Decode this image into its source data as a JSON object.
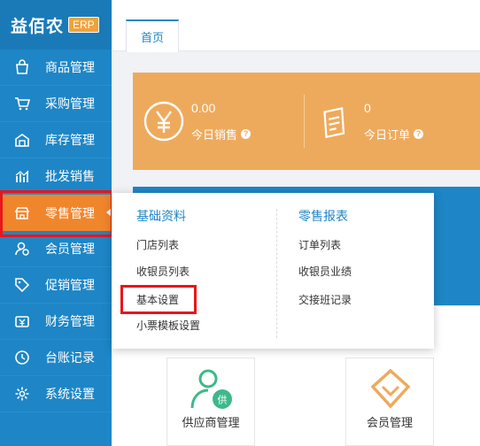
{
  "app": {
    "name": "益佰农",
    "badge": "ERP"
  },
  "sidebar": {
    "items": [
      {
        "label": "商品管理",
        "icon": "bag-icon"
      },
      {
        "label": "采购管理",
        "icon": "cart-icon"
      },
      {
        "label": "库存管理",
        "icon": "warehouse-icon"
      },
      {
        "label": "批发销售",
        "icon": "chart-icon"
      },
      {
        "label": "零售管理",
        "icon": "store-icon"
      },
      {
        "label": "会员管理",
        "icon": "member-icon"
      },
      {
        "label": "促销管理",
        "icon": "tag-icon"
      },
      {
        "label": "财务管理",
        "icon": "finance-icon"
      },
      {
        "label": "台账记录",
        "icon": "clock-icon"
      },
      {
        "label": "系统设置",
        "icon": "gear-icon"
      }
    ],
    "active_index": 4
  },
  "tabs": [
    {
      "label": "首页"
    }
  ],
  "stats": [
    {
      "value": "0.00",
      "label": "今日销售"
    },
    {
      "value": "0",
      "label": "今日订单"
    }
  ],
  "dropdown": {
    "col1": {
      "title": "基础资料",
      "items": [
        "门店列表",
        "收银员列表",
        "基本设置",
        "小票模板设置"
      ]
    },
    "col2": {
      "title": "零售报表",
      "items": [
        "订单列表",
        "收银员业绩",
        "交接班记录"
      ]
    }
  },
  "cards": [
    {
      "label": "供应商管理"
    },
    {
      "label": "会员管理"
    }
  ],
  "colors": {
    "sidebar": "#1e86c6",
    "accent_orange": "#f0862c",
    "stat_bg": "#eeaa5c",
    "highlight_red": "#e8161b"
  }
}
